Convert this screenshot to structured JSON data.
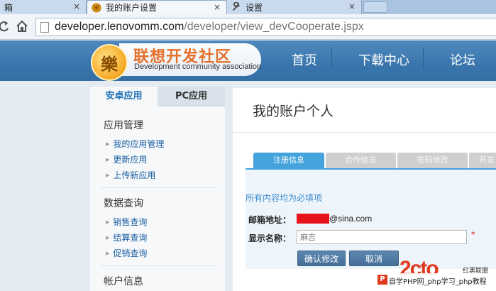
{
  "browser": {
    "tabs": [
      {
        "title": "箱",
        "icon": "page-icon"
      },
      {
        "title": "我的账户设置",
        "icon": "lenovo-logo-icon"
      },
      {
        "title": "设置",
        "icon": "wrench-icon"
      }
    ],
    "close_glyph": "×",
    "address": {
      "domain": "developer.lenovomm.com",
      "path": "/developer/view_devCooperate.jspx"
    }
  },
  "header": {
    "logo_mark": "樂",
    "logo_title": "联想开发社区",
    "logo_subtitle": "Development community association",
    "nav": [
      "首页",
      "下载中心",
      "论坛"
    ]
  },
  "sidebar": {
    "tabs": [
      "安卓应用",
      "PC应用"
    ],
    "groups": [
      {
        "title": "应用管理",
        "links": [
          "我的应用管理",
          "更新应用",
          "上传新应用"
        ]
      },
      {
        "title": "数据查询",
        "links": [
          "销售查询",
          "结算查询",
          "促销查询"
        ]
      },
      {
        "title": "帐户信息",
        "links": []
      }
    ]
  },
  "main": {
    "title": "我的账户个人",
    "tabs": [
      "注册信息",
      "合作信息",
      "密码修改",
      "开发"
    ],
    "note": "所有内容均为必填项",
    "email_label": "邮箱地址：",
    "email_suffix": "@sina.com",
    "name_label": "显示名称：",
    "name_value": "麻吉",
    "required_mark": "*",
    "confirm_button": "确认修改",
    "cancel_button": "取消"
  },
  "watermark": {
    "logo": "2cto",
    "brand": "红黑联盟",
    "icon_letter": "P",
    "text": "自学PHP网_php学习_php教程"
  },
  "colors": {
    "accent": "#45a3dc",
    "header_blue": "#3a76ad",
    "logo_orange": "#e3702a",
    "redaction": "#e8131a"
  }
}
